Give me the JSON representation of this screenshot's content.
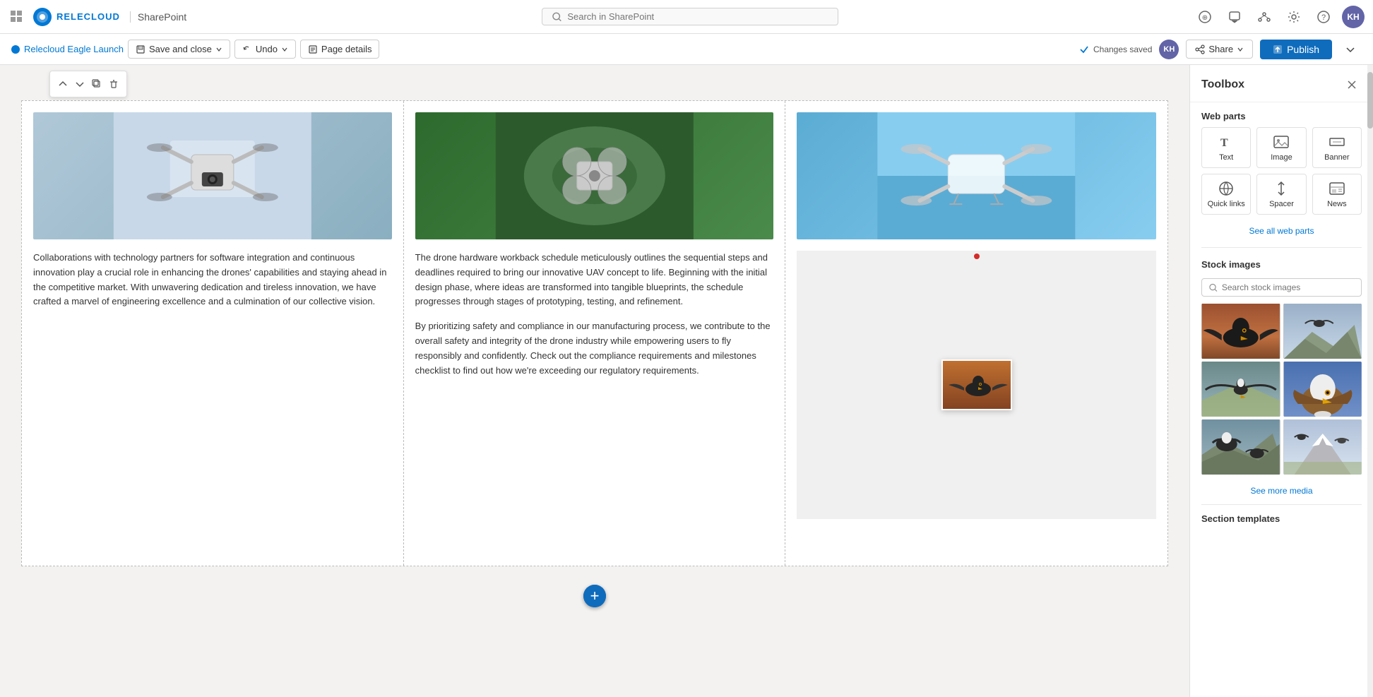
{
  "app": {
    "grid_icon": "⊞",
    "logo_text": "RELECLOUD",
    "app_name": "SharePoint",
    "search_placeholder": "Search in SharePoint",
    "user_initials": "KH"
  },
  "edit_bar": {
    "site_name": "Relecloud Eagle Launch",
    "save_label": "Save and close",
    "undo_label": "Undo",
    "page_details_label": "Page details",
    "changes_saved": "Changes saved",
    "share_label": "Share",
    "publish_label": "Publish"
  },
  "toolbox": {
    "title": "Toolbox",
    "web_parts_label": "Web parts",
    "see_all_label": "See all web parts",
    "web_parts": [
      {
        "id": "text",
        "label": "Text",
        "icon": "T"
      },
      {
        "id": "image",
        "label": "Image",
        "icon": "🖼"
      },
      {
        "id": "banner",
        "label": "Banner",
        "icon": "▬"
      },
      {
        "id": "quick-links",
        "label": "Quick links",
        "icon": "🌐"
      },
      {
        "id": "spacer",
        "label": "Spacer",
        "icon": "↕"
      },
      {
        "id": "news",
        "label": "News",
        "icon": "📰"
      }
    ],
    "stock_images_label": "Stock images",
    "stock_search_placeholder": "Search stock images",
    "see_more_label": "See more media",
    "section_templates_label": "Section templates"
  },
  "content": {
    "col1": {
      "text1": "Collaborations with technology partners for software integration and continuous innovation play a crucial role in enhancing the drones' capabilities and staying ahead in the competitive market. With unwavering dedication and tireless innovation, we have crafted a marvel of engineering excellence and a culmination of our collective vision."
    },
    "col2": {
      "text1": "The drone hardware workback schedule meticulously outlines the sequential steps and deadlines required to bring our innovative UAV concept to life. Beginning with the initial design phase, where ideas are transformed into tangible blueprints, the schedule progresses through stages of prototyping, testing, and refinement.",
      "text2": "By prioritizing safety and compliance in our manufacturing process, we contribute to the overall safety and integrity of the drone industry while empowering users to fly responsibly and confidently. Check out the compliance requirements and milestones checklist to find out how we're exceeding our regulatory requirements."
    }
  }
}
